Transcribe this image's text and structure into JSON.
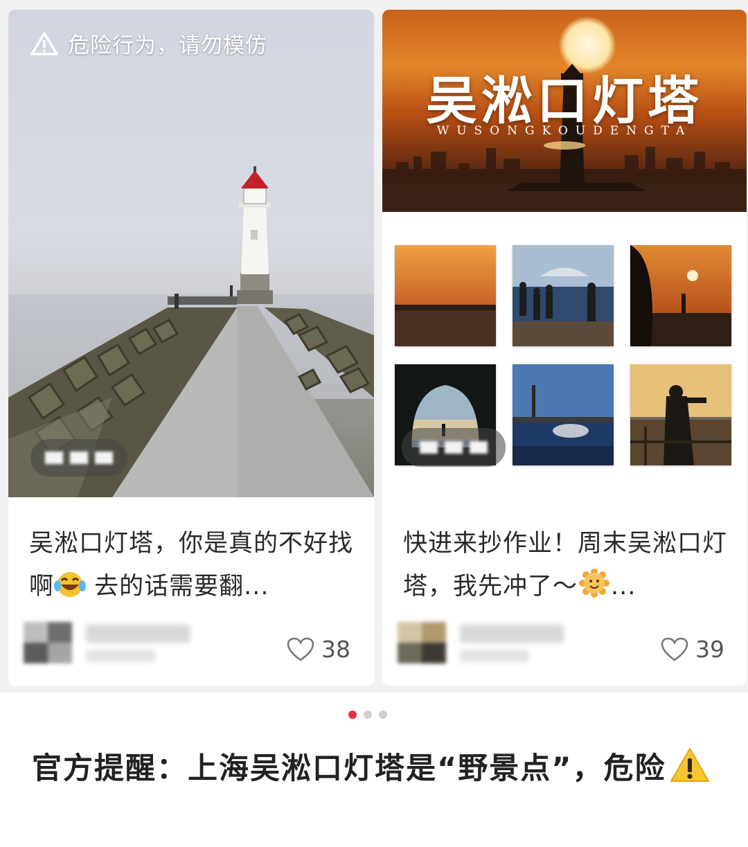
{
  "feed": {
    "cards": [
      {
        "warning_banner": "危险行为，请勿模仿",
        "title": "吴淞口灯塔，你是真的不好找啊",
        "title_tail": " 去的话需要翻...",
        "title_emoji": "laughing-tears-emoji",
        "like_count": "38"
      },
      {
        "poster_title": "吴淞口灯塔",
        "poster_subtitle": "WUSONGKOUDENGTA",
        "title": "快进来抄作业！周末吴淞口灯塔，我先冲了～",
        "title_tail": "...",
        "title_emoji": "smiling-sun-emoji",
        "like_count": "39"
      }
    ]
  },
  "pager": {
    "total": 3,
    "active": 0
  },
  "article": {
    "headline": "官方提醒：上海吴淞口灯塔是“野景点”，危险",
    "headline_emoji": "warning-emoji"
  },
  "colors": {
    "pager_active": "#e8323b",
    "poster_orange": "#e2862b"
  }
}
